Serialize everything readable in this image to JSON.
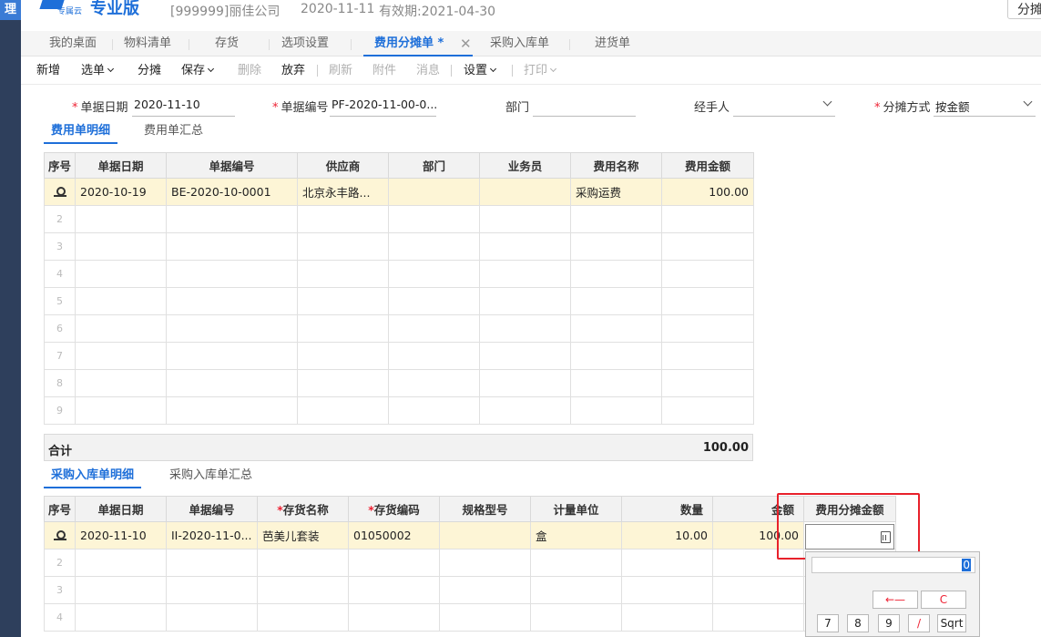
{
  "rail": {
    "glyph": "理"
  },
  "header": {
    "logo_sub": "专属云",
    "logo_text": "专业版",
    "company": "[999999]丽佳公司",
    "date": "2020-11-11",
    "valid_until": "有效期:2021-04-30",
    "corner_button": "分摊"
  },
  "tabs": [
    {
      "label": "我的桌面"
    },
    {
      "label": "物料清单"
    },
    {
      "label": "存货"
    },
    {
      "label": "选项设置"
    },
    {
      "label": "费用分摊单 *"
    },
    {
      "label": "采购入库单"
    },
    {
      "label": "进货单"
    }
  ],
  "tab_close": "✕",
  "toolbar": {
    "new": "新增",
    "select": "选单",
    "allocate": "分摊",
    "save": "保存",
    "delete": "删除",
    "discard": "放弃",
    "refresh": "刷新",
    "attachment": "附件",
    "message": "消息",
    "settings": "设置",
    "print": "打印"
  },
  "form": {
    "date_label": "单据日期",
    "date_value": "2020-11-10",
    "code_label": "单据编号",
    "code_value": "PF-2020-11-00-0...",
    "dept_label": "部门",
    "dept_value": "",
    "handler_label": "经手人",
    "handler_value": "",
    "method_label": "分摊方式",
    "method_value": "按金额"
  },
  "expense_section": {
    "tabs": [
      "费用单明细",
      "费用单汇总"
    ],
    "columns": [
      "序号",
      "单据日期",
      "单据编号",
      "供应商",
      "部门",
      "业务员",
      "费用名称",
      "费用金额"
    ],
    "rows": [
      {
        "date": "2020-10-19",
        "code": "BE-2020-10-0001",
        "supplier": "北京永丰路...",
        "dept": "",
        "clerk": "",
        "name": "采购运费",
        "amount": "100.00"
      },
      {
        "idx": "2"
      },
      {
        "idx": "3"
      },
      {
        "idx": "4"
      },
      {
        "idx": "5"
      },
      {
        "idx": "6"
      },
      {
        "idx": "7"
      },
      {
        "idx": "8"
      },
      {
        "idx": "9"
      }
    ],
    "total_label": "合计",
    "total_value": "100.00"
  },
  "receipt_section": {
    "tabs": [
      "采购入库单明细",
      "采购入库单汇总"
    ],
    "columns": [
      "序号",
      "单据日期",
      "单据编号",
      "存货名称",
      "存货编码",
      "规格型号",
      "计量单位",
      "数量",
      "金额",
      "费用分摊金额"
    ],
    "required_mark": "*",
    "rows": [
      {
        "date": "2020-11-10",
        "code": "II-2020-11-0...",
        "name": "芭美儿套装",
        "item_code": "01050002",
        "spec": "",
        "unit": "盒",
        "qty": "10.00",
        "amount": "100.00"
      },
      {
        "idx": "2"
      },
      {
        "idx": "3"
      },
      {
        "idx": "4"
      }
    ]
  },
  "calculator": {
    "display": "0",
    "backspace": "←—",
    "clear": "C",
    "keys": [
      "7",
      "8",
      "9",
      "/",
      "Sqrt"
    ]
  }
}
